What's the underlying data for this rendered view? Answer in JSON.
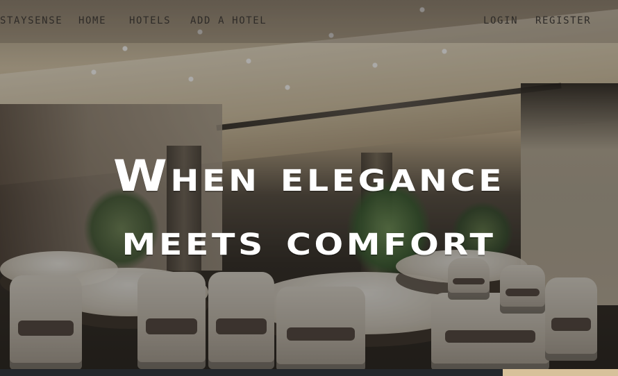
{
  "nav": {
    "brand": "STAYSENSE",
    "links": {
      "home": "HOME",
      "hotels": "HOTELS",
      "add_hotel": "ADD A HOTEL",
      "login": "LOGIN",
      "register": "REGISTER"
    }
  },
  "hero": {
    "title_line1": "When elegance",
    "title_line2": "meets comfort"
  },
  "colors": {
    "nav_text": "#2e2b28",
    "title_text": "#ffffff",
    "bottom_bar": "#23272b",
    "bottom_accent": "#d7c19a"
  }
}
